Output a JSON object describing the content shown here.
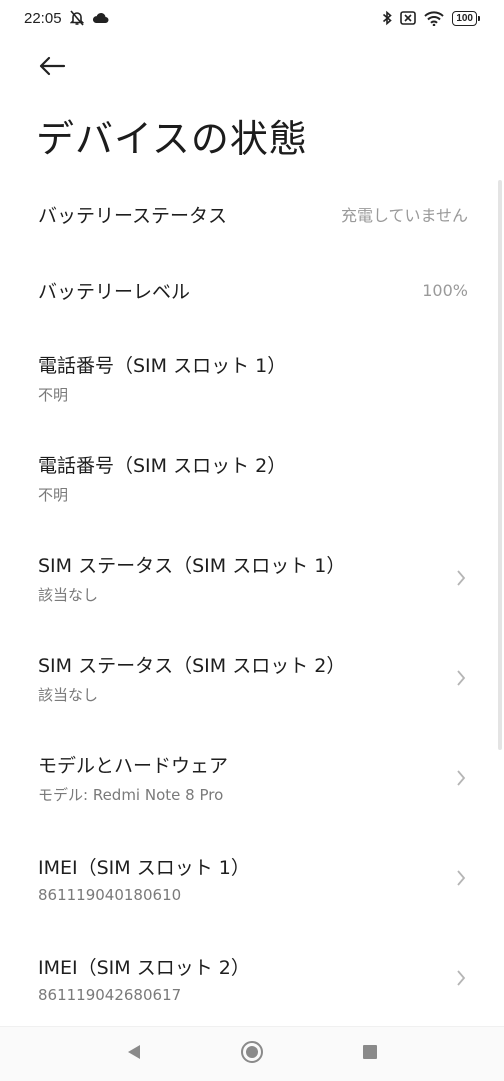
{
  "status_bar": {
    "time": "22:05",
    "battery": "100",
    "left_icons": [
      "bell-off-icon",
      "cloud-icon"
    ],
    "right_icons": [
      "bluetooth-icon",
      "no-sim-icon",
      "wifi-icon",
      "battery-icon"
    ]
  },
  "header": {
    "back_icon": "arrow-left-icon",
    "title": "デバイスの状態"
  },
  "items": [
    {
      "title": "バッテリーステータス",
      "value": "充電していません"
    },
    {
      "title": "バッテリーレベル",
      "value": "100%"
    },
    {
      "title": "電話番号（SIM スロット 1）",
      "subtitle": "不明"
    },
    {
      "title": "電話番号（SIM スロット 2）",
      "subtitle": "不明"
    },
    {
      "title": "SIM ステータス（SIM スロット 1）",
      "subtitle": "該当なし",
      "chevron": true
    },
    {
      "title": "SIM ステータス（SIM スロット 2）",
      "subtitle": "該当なし",
      "chevron": true
    },
    {
      "title": "モデルとハードウェア",
      "subtitle": "モデル: Redmi Note 8 Pro",
      "chevron": true
    },
    {
      "title": "IMEI（SIM スロット 1）",
      "subtitle": "861119040180610",
      "chevron": true
    },
    {
      "title": "IMEI（SIM スロット 2）",
      "subtitle": "861119042680617",
      "chevron": true
    }
  ],
  "nav_bar": {
    "icons": [
      "back-triangle-icon",
      "home-circle-icon",
      "recents-square-icon"
    ]
  },
  "colors": {
    "text_primary": "#1e1e1e",
    "text_secondary": "#7a7a7a",
    "value_text": "#9a9a9a",
    "background": "#ffffff"
  }
}
